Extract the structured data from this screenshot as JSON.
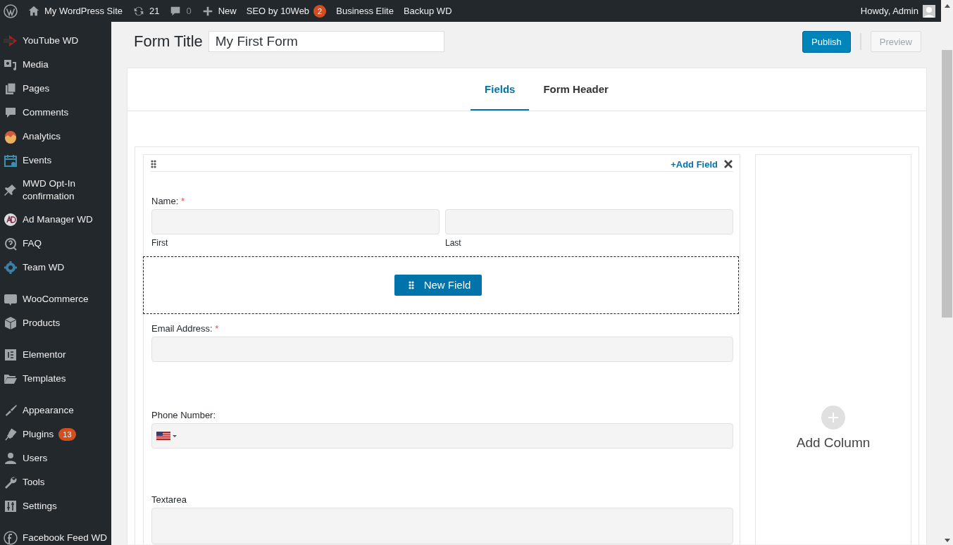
{
  "admin_bar": {
    "left": [
      {
        "kind": "logo"
      },
      {
        "kind": "home",
        "label": "My WordPress Site"
      },
      {
        "kind": "updates",
        "label": "21"
      },
      {
        "kind": "comments",
        "label": "0"
      },
      {
        "kind": "new",
        "label": "New"
      },
      {
        "kind": "text",
        "label": "SEO by 10Web",
        "badge": "2"
      },
      {
        "kind": "text",
        "label": "Business Elite"
      },
      {
        "kind": "text",
        "label": "Backup WD"
      }
    ],
    "greeting": "Howdy, Admin"
  },
  "sidebar": {
    "groups": [
      {
        "items": [
          {
            "label": "YouTube WD"
          },
          {
            "label": "Media"
          },
          {
            "label": "Pages"
          },
          {
            "label": "Comments"
          },
          {
            "label": "Analytics"
          },
          {
            "label": "Events"
          },
          {
            "label": "MWD Opt-In confirmation"
          },
          {
            "label": "Ad Manager WD"
          },
          {
            "label": "FAQ"
          },
          {
            "label": "Team WD"
          }
        ]
      },
      {
        "items": [
          {
            "label": "WooCommerce"
          },
          {
            "label": "Products"
          }
        ]
      },
      {
        "items": [
          {
            "label": "Elementor"
          },
          {
            "label": "Templates"
          }
        ]
      },
      {
        "items": [
          {
            "label": "Appearance"
          },
          {
            "label": "Plugins",
            "badge": "13"
          },
          {
            "label": "Users"
          },
          {
            "label": "Tools"
          },
          {
            "label": "Settings"
          }
        ]
      },
      {
        "items": [
          {
            "label": "Facebook Feed WD"
          }
        ]
      }
    ]
  },
  "header": {
    "title_label": "Form Title",
    "title_value": "My First Form",
    "publish": "Publish",
    "preview": "Preview"
  },
  "tabs": [
    {
      "label": "Fields",
      "selected": true
    },
    {
      "label": "Form Header",
      "selected": false
    }
  ],
  "column": {
    "add_field": "+Add Field",
    "fields": [
      {
        "kind": "name",
        "label": "Name:",
        "required_mark": "*",
        "sublabels": [
          "First",
          "Last"
        ]
      },
      {
        "kind": "drop_zone",
        "label": "New Field"
      },
      {
        "kind": "text",
        "label": "Email Address:",
        "required_mark": "*"
      },
      {
        "kind": "phone",
        "label": "Phone Number:"
      },
      {
        "kind": "textarea",
        "label": "Textarea"
      }
    ]
  },
  "add_column": "Add Column"
}
